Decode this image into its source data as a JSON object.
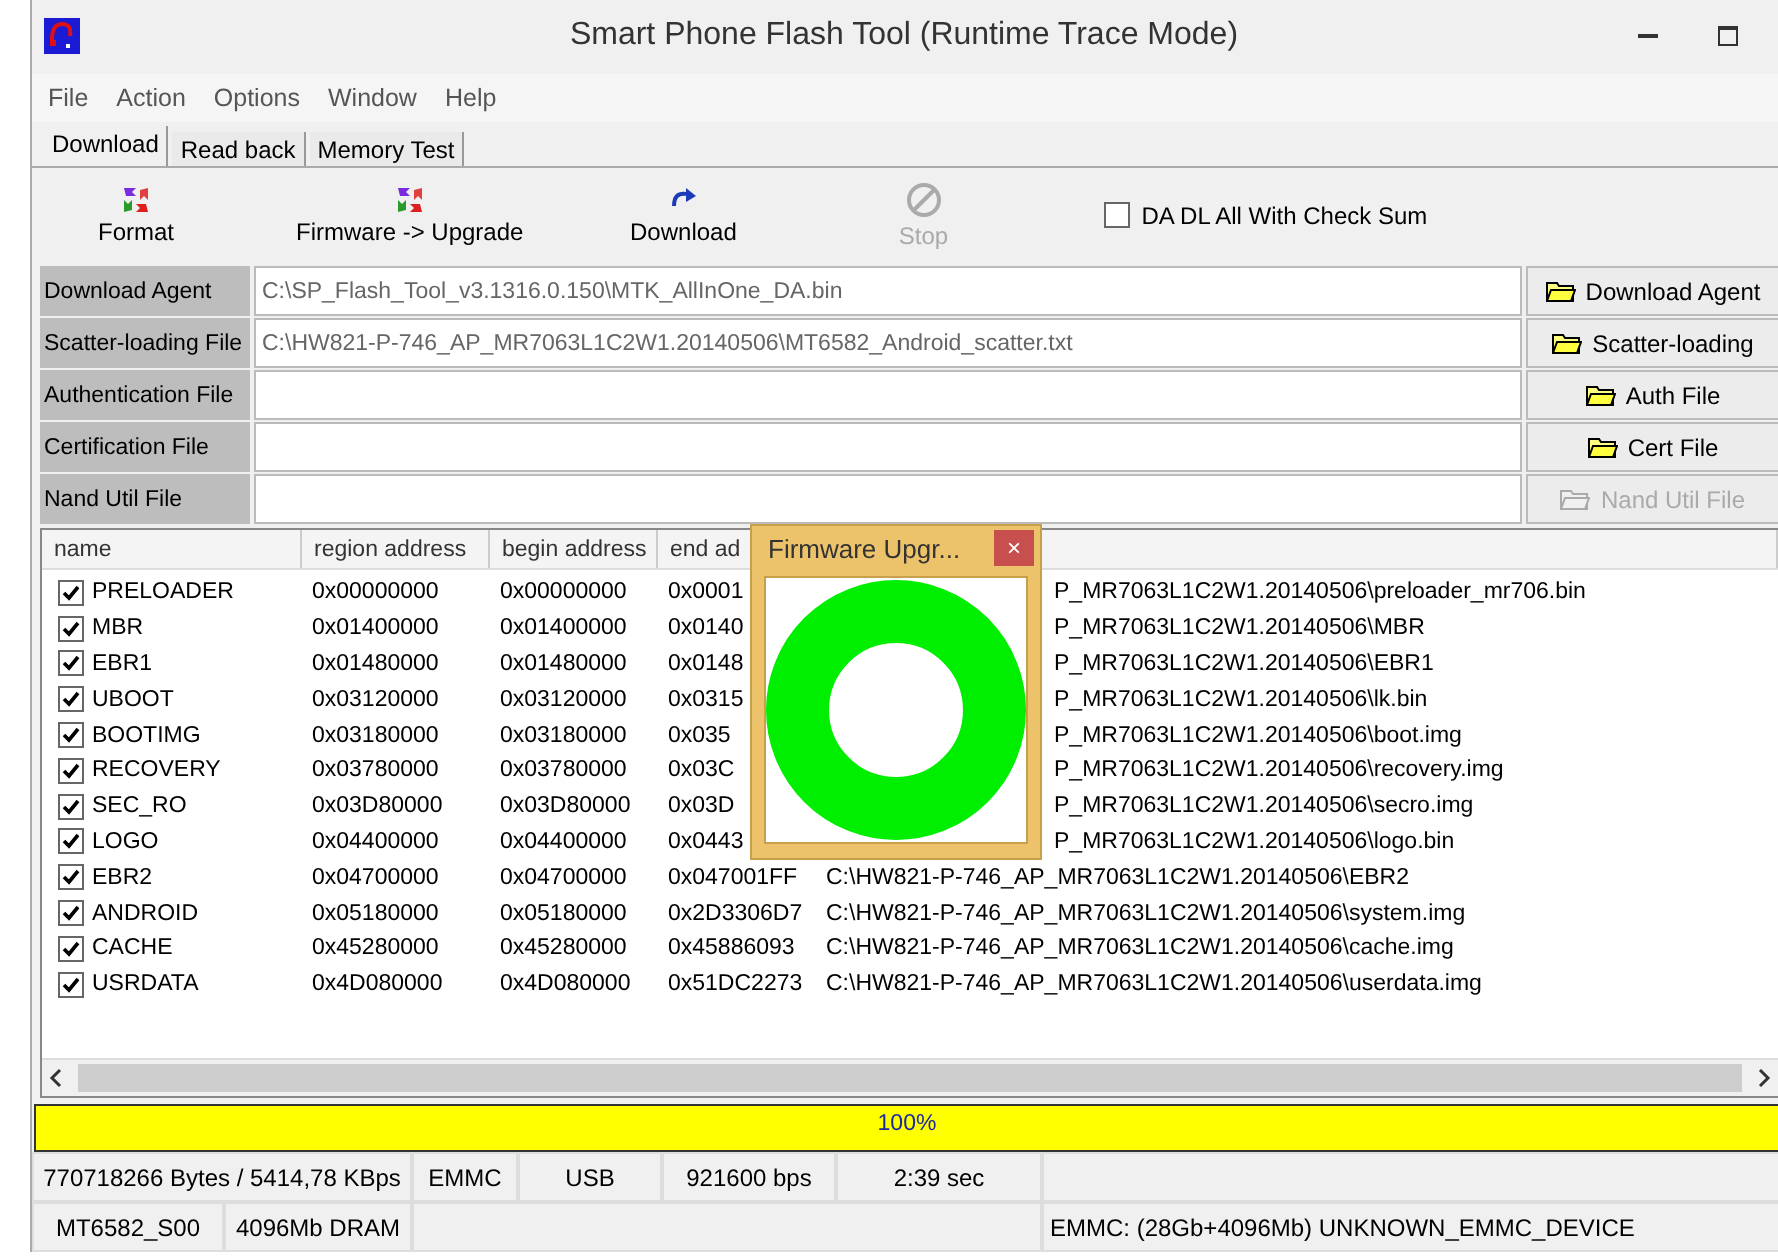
{
  "window": {
    "title": "Smart Phone Flash Tool (Runtime Trace Mode)"
  },
  "menu": [
    "File",
    "Action",
    "Options",
    "Window",
    "Help"
  ],
  "tabs": [
    {
      "label": "Download",
      "selected": true
    },
    {
      "label": "Read back",
      "selected": false
    },
    {
      "label": "Memory Test",
      "selected": false
    }
  ],
  "toolbar": [
    {
      "label": "Format",
      "kind": "format",
      "disabled": false
    },
    {
      "label": "Firmware -> Upgrade",
      "kind": "format",
      "disabled": false
    },
    {
      "label": "Download",
      "kind": "download",
      "disabled": false
    },
    {
      "label": "Stop",
      "kind": "stop",
      "disabled": true
    }
  ],
  "checksum": {
    "label": "DA DL All With Check Sum",
    "checked": false
  },
  "files": [
    {
      "label": "Download Agent",
      "value": "C:\\SP_Flash_Tool_v3.1316.0.150\\MTK_AllInOne_DA.bin",
      "button": "Download Agent",
      "disabled": false
    },
    {
      "label": "Scatter-loading File",
      "value": "C:\\HW821-P-746_AP_MR7063L1C2W1.20140506\\MT6582_Android_scatter.txt",
      "button": "Scatter-loading",
      "disabled": false
    },
    {
      "label": "Authentication File",
      "button": "Auth File",
      "disabled": false
    },
    {
      "label": "Certification File",
      "button": "Cert File",
      "disabled": false
    },
    {
      "label": "Nand Util File",
      "button": "Nand Util File",
      "disabled": true
    }
  ],
  "table": {
    "columns": [
      "name",
      "region address",
      "begin address",
      "end ad"
    ],
    "rows": [
      {
        "name": "PRELOADER",
        "checked": true,
        "region": "0x00000000",
        "begin": "0x00000000",
        "end": "0x0001",
        "file": "P_MR7063L1C2W1.20140506\\preloader_mr706.bin"
      },
      {
        "name": "MBR",
        "checked": true,
        "region": "0x01400000",
        "begin": "0x01400000",
        "end": "0x0140",
        "file": "P_MR7063L1C2W1.20140506\\MBR"
      },
      {
        "name": "EBR1",
        "checked": true,
        "region": "0x01480000",
        "begin": "0x01480000",
        "end": "0x0148",
        "file": "P_MR7063L1C2W1.20140506\\EBR1"
      },
      {
        "name": "UBOOT",
        "checked": true,
        "region": "0x03120000",
        "begin": "0x03120000",
        "end": "0x0315",
        "file": "P_MR7063L1C2W1.20140506\\lk.bin"
      },
      {
        "name": "BOOTIMG",
        "checked": true,
        "region": "0x03180000",
        "begin": "0x03180000",
        "end": "0x035",
        "file": "P_MR7063L1C2W1.20140506\\boot.img"
      },
      {
        "name": "RECOVERY",
        "checked": true,
        "region": "0x03780000",
        "begin": "0x03780000",
        "end": "0x03C",
        "file": "P_MR7063L1C2W1.20140506\\recovery.img"
      },
      {
        "name": "SEC_RO",
        "checked": true,
        "region": "0x03D80000",
        "begin": "0x03D80000",
        "end": "0x03D",
        "file": "P_MR7063L1C2W1.20140506\\secro.img"
      },
      {
        "name": "LOGO",
        "checked": true,
        "region": "0x04400000",
        "begin": "0x04400000",
        "end": "0x0443",
        "file": "P_MR7063L1C2W1.20140506\\logo.bin"
      },
      {
        "name": "EBR2",
        "checked": true,
        "region": "0x04700000",
        "begin": "0x04700000",
        "end": "0x047001FF",
        "file": "C:\\HW821-P-746_AP_MR7063L1C2W1.20140506\\EBR2"
      },
      {
        "name": "ANDROID",
        "checked": true,
        "region": "0x05180000",
        "begin": "0x05180000",
        "end": "0x2D3306D7",
        "file": "C:\\HW821-P-746_AP_MR7063L1C2W1.20140506\\system.img"
      },
      {
        "name": "CACHE",
        "checked": true,
        "region": "0x45280000",
        "begin": "0x45280000",
        "end": "0x45886093",
        "file": "C:\\HW821-P-746_AP_MR7063L1C2W1.20140506\\cache.img"
      },
      {
        "name": "USRDATA",
        "checked": true,
        "region": "0x4D080000",
        "begin": "0x4D080000",
        "end": "0x51DC2273",
        "file": "C:\\HW821-P-746_AP_MR7063L1C2W1.20140506\\userdata.img"
      }
    ]
  },
  "popup": {
    "title": "Firmware Upgr...",
    "close": "×"
  },
  "progress": {
    "level": 1,
    "label": "100%"
  },
  "status_bar": {
    "transfer": "770718266 Bytes / 5414,78 KBps",
    "storage": "EMMC",
    "port": "USB",
    "baud": "921600 bps",
    "time": "2:39 sec",
    "chip": "MT6582_S00",
    "memory": "4096Mb DRAM",
    "device": "EMMC: (28Gb+4096Mb) UNKNOWN_EMMC_DEVICE"
  }
}
